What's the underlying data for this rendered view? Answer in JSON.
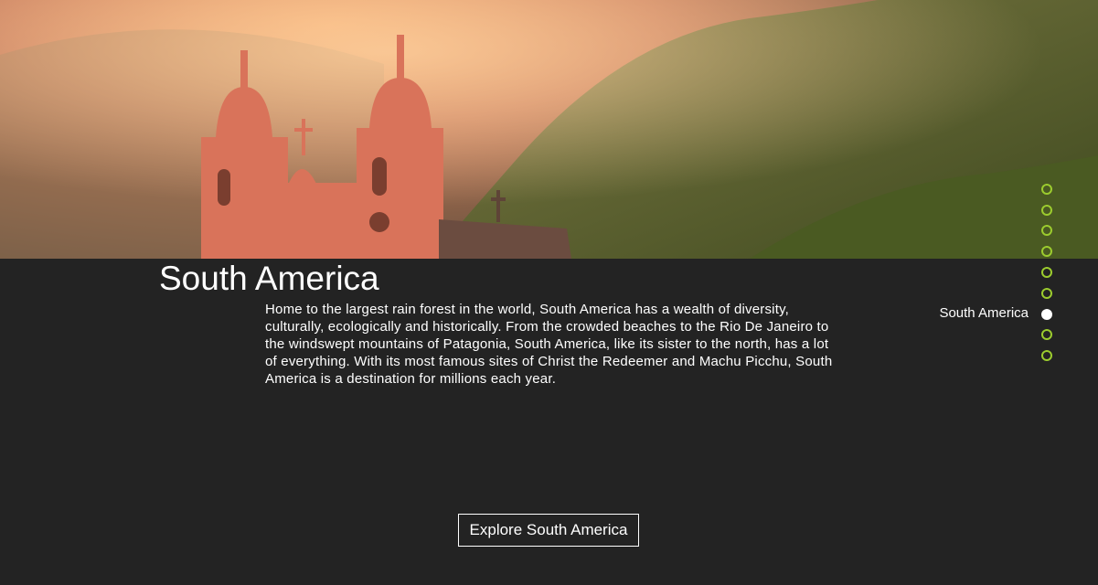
{
  "hero": {
    "image_alt": "Colonial church towers against green mountain slopes at sunrise"
  },
  "section": {
    "title": "South America",
    "description": "Home to the largest rain forest in the world, South America has a wealth of diversity, culturally, ecologically and historically. From the crowded beaches to the Rio De Janeiro to the windswept mountains of Patagonia, South America, like its sister to the north, has a lot of everything. With its most famous sites of Christ the Redeemer and Machu Picchu, South America is a destination for millions each year.",
    "cta_label": "Explore South America"
  },
  "nav_dots": {
    "active_label": "South America",
    "count": 9,
    "active_index": 6,
    "accent_color": "#9ccc2e",
    "active_color": "#ffffff"
  }
}
